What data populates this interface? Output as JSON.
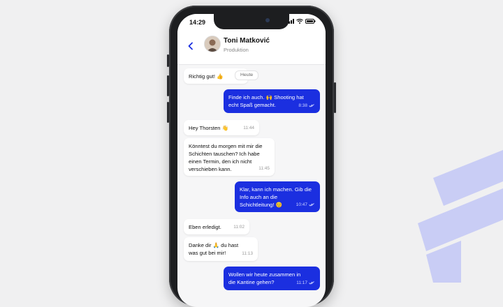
{
  "status_bar": {
    "time": "14:29"
  },
  "header": {
    "name": "Toni Matković",
    "role": "Produktion"
  },
  "date_separator": "Heute",
  "messages": [
    {
      "dir": "in",
      "text": "Richtig gut! 👍",
      "time": ""
    },
    {
      "dir": "out",
      "text": "Finde ich auch. 🙌 Shooting hat echt Spaß gemacht.",
      "time": "8:38"
    },
    {
      "dir": "in",
      "text": "Hey Thorsten 👋",
      "time": "11:44"
    },
    {
      "dir": "in",
      "text": "Könntest du morgen mit mir die Schichten tauschen? Ich habe einen Termin, den ich nicht verschieben kann.",
      "time": "11:45"
    },
    {
      "dir": "out",
      "text": "Klar, kann ich machen. Gib die Info auch an die Schichtleitung! 😊",
      "time": "10:47"
    },
    {
      "dir": "in",
      "text": "Eben erledigt.",
      "time": "11:02"
    },
    {
      "dir": "in",
      "text": "Danke dir 🙏 du hast was gut bei mir!",
      "time": "11:13"
    },
    {
      "dir": "out",
      "text": "Wollen wir heute zusammen in die Kantine gehen?",
      "time": "11:17"
    }
  ],
  "colors": {
    "accent": "#1b2fe0",
    "brand_shape": "#c9cdf5"
  }
}
